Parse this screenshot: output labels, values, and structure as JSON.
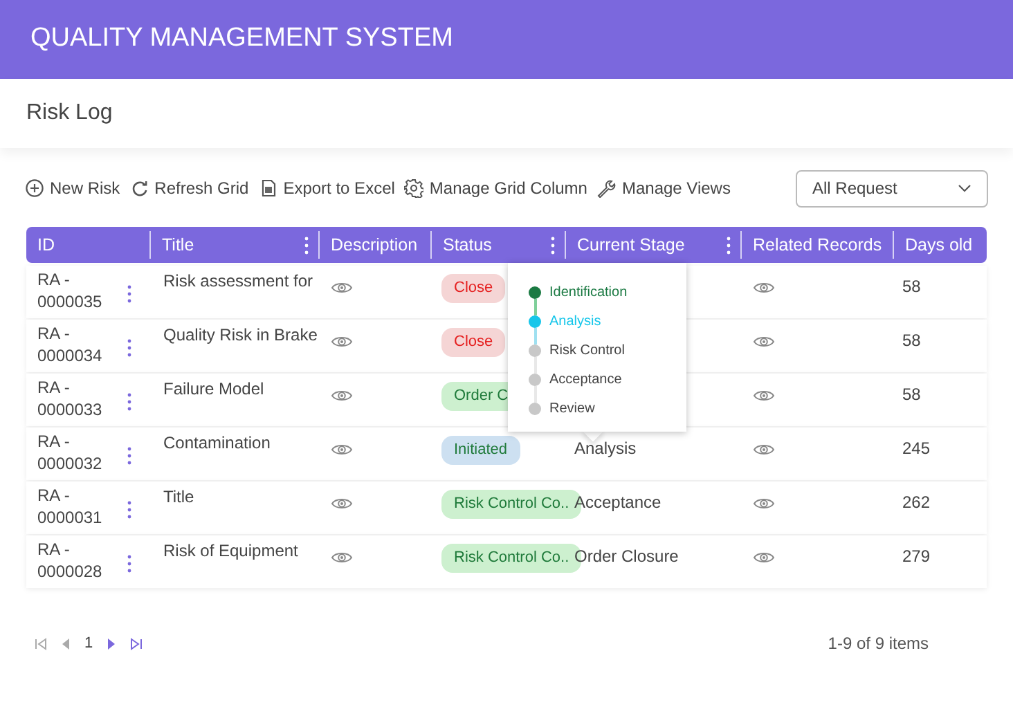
{
  "app_title": "QUALITY MANAGEMENT SYSTEM",
  "page_title": "Risk Log",
  "toolbar": [
    {
      "label": "New Risk"
    },
    {
      "label": "Refresh Grid"
    },
    {
      "label": "Export to Excel"
    },
    {
      "label": "Manage Grid Column"
    },
    {
      "label": "Manage Views"
    }
  ],
  "view_select": {
    "value": "All Request"
  },
  "table": {
    "columns": [
      {
        "label": "ID",
        "menu": false
      },
      {
        "label": "Title",
        "menu": true
      },
      {
        "label": "Description",
        "menu": false
      },
      {
        "label": "Status",
        "menu": true
      },
      {
        "label": "Current Stage",
        "menu": true
      },
      {
        "label": "Related Records",
        "menu": false
      },
      {
        "label": "Days old",
        "menu": false
      }
    ],
    "rows": [
      {
        "id": "RA - 0000035",
        "title": "Risk assessment for",
        "status": {
          "label": "Close",
          "kind": "closed"
        },
        "days_old": "58"
      },
      {
        "id": "RA - 0000034",
        "title": "Quality Risk in Brake",
        "status": {
          "label": "Close",
          "kind": "closed"
        },
        "days_old": "58"
      },
      {
        "id": "RA - 0000033",
        "title": "Failure Model",
        "status": {
          "label": "Order C",
          "kind": "completed"
        },
        "days_old": "58"
      },
      {
        "id": "RA - 0000032",
        "title": "Contamination",
        "status": {
          "label": "Initiated",
          "kind": "initiated"
        },
        "current_stage": "Analysis",
        "days_old": "245"
      },
      {
        "id": "RA - 0000031",
        "title": "Title",
        "status": {
          "label": "Risk Control Co..",
          "kind": "completed"
        },
        "current_stage": "Acceptance",
        "days_old": "262"
      },
      {
        "id": "RA - 0000028",
        "title": "Risk of Equipment",
        "status": {
          "label": "Risk Control Co..",
          "kind": "completed"
        },
        "current_stage": "Order Closure",
        "days_old": "279"
      }
    ]
  },
  "stage_popup": {
    "stages": [
      {
        "label": "Identification",
        "completed": true,
        "selected": false
      },
      {
        "label": "Analysis",
        "completed": false,
        "selected": true
      },
      {
        "label": "Risk Control",
        "completed": false,
        "selected": false
      },
      {
        "label": "Acceptance",
        "completed": false,
        "selected": false
      },
      {
        "label": "Review",
        "completed": false,
        "selected": false
      }
    ]
  },
  "pager": {
    "first": {
      "disabled": true
    },
    "prev": {
      "disabled": true
    },
    "page": "1",
    "next": {
      "disabled": false
    },
    "last": {
      "disabled": false
    },
    "summary": "1-9 of 9 items"
  }
}
